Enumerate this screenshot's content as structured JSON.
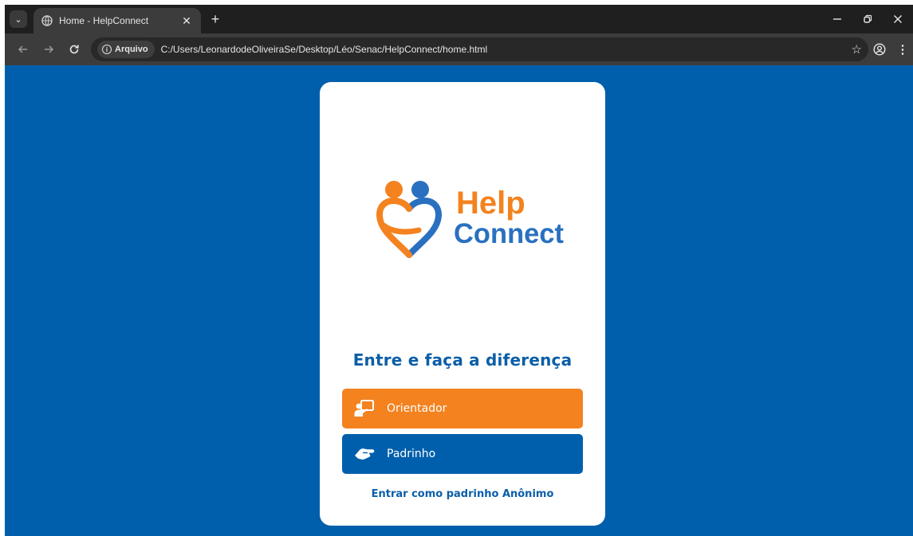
{
  "browser": {
    "tab_title": "Home - HelpConnect",
    "tab_close": "✕",
    "new_tab": "+",
    "security_chip": "Arquivo",
    "url": "C:/Users/LeonardodeOliveiraSe/Desktop/Léo/Senac/HelpConnect/home.html",
    "icons": [
      "tab-list-icon",
      "globe-icon",
      "back-icon",
      "forward-icon",
      "reload-icon",
      "info-icon",
      "star-icon",
      "profile-icon",
      "menu-icon",
      "minimize-icon",
      "restore-icon",
      "close-window-icon"
    ]
  },
  "brand": {
    "name_line1": "Help",
    "name_line2": "Connect",
    "colors": {
      "orange": "#f3821f",
      "blue": "#005fac",
      "background": "#005fac"
    }
  },
  "main": {
    "tagline": "Entre e faça a diferença",
    "buttons": [
      {
        "label": "Orientador",
        "icon": "presenter-icon",
        "color": "#f3821f"
      },
      {
        "label": "Padrinho",
        "icon": "handshake-icon",
        "color": "#005fac"
      }
    ],
    "anonymous_link": "Entrar como padrinho Anônimo"
  }
}
